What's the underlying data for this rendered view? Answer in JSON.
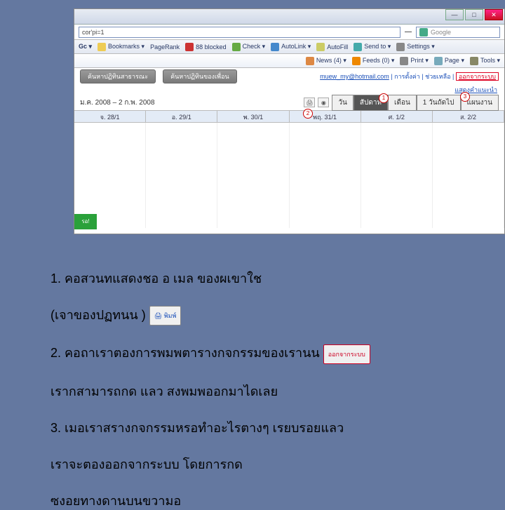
{
  "browser": {
    "url_partial": "cor'pi=1",
    "nav_collapse": "—",
    "search_placeholder": "Google",
    "toolbar1": {
      "bookmarks": "Bookmarks ▾",
      "pagerank": "PageRank",
      "blocked": "88 blocked",
      "check": "Check ▾",
      "autolink": "AutoLink ▾",
      "autofill": "AutoFill",
      "sendto": "Send to ▾",
      "settings": "Settings ▾"
    },
    "toolbar2": {
      "news": "News (4) ▾",
      "feeds": "Feeds (0) ▾",
      "print": "Print ▾",
      "page": "Page ▾",
      "tools": "Tools ▾"
    }
  },
  "calendar": {
    "button_search_public": "ค้นหาปฏิทินสาธารณะ",
    "button_search_friend": "ค้นหาปฏิทินของเพื่อน",
    "right_email": "muew_my@hotmail.com",
    "right_link1": "การตั้งค่า",
    "right_link2": "ช่วยเหลือ",
    "right_logout": "ออกจากระบบ",
    "small_link": "แสดงคำแนะนำ",
    "date_range": "ม.ค. 2008 – 2 ก.พ. 2008",
    "views": {
      "day": "วัน",
      "week": "สัปดาห์",
      "month": "เดือน",
      "ndays": "1 วันถัดไป",
      "agenda": "แผนงาน"
    },
    "days": [
      "จ. 28/1",
      "อ. 29/1",
      "พ. 30/1",
      "พฤ. 31/1",
      "ศ. 1/2",
      "ส. 2/2"
    ],
    "sidebar_tag": "รอ!"
  },
  "annotations": {
    "circ1": "1",
    "circ2": "2",
    "circ3": "3",
    "explanation_line1": "1. คอสวนทแสดงชอ          อ เมล ของผเขาใช",
    "explanation_line2": "(เจาของปฏทนน          )       ",
    "inline_print": "🖨 พิมพ์",
    "explanation_line3": "2. คอถาเราตองการพมพตารางกจกรรมของเรานน          ",
    "inline_logout": "ออกจากระบบ",
    "explanation_line4": "เรากสามารถกด          แลว สงพมพออกมาไดเลย",
    "explanation_line5": "3. เมอเราสรางกจกรรมหรอทำอะไรตางๆ           เรยบรอยแลว",
    "explanation_line6": "เราจะตองออกจากระบบ โดยการกด",
    "explanation_line7": "ซงอยทางดานบนขวามอ"
  }
}
